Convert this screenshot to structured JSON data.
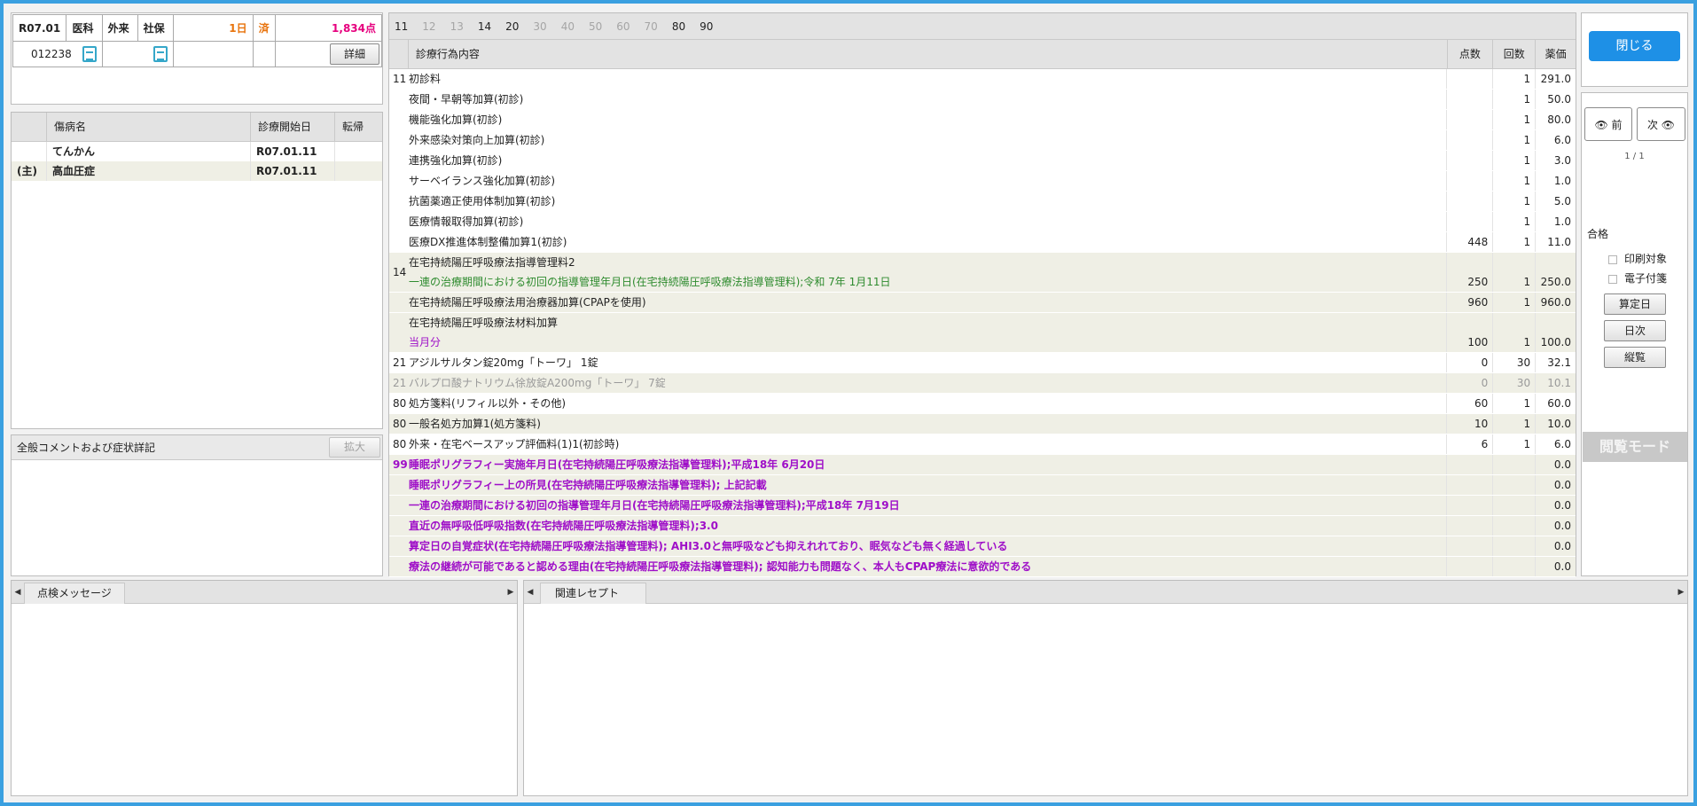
{
  "header": {
    "era_month": "R07.01",
    "department": "医科",
    "visit_type": "外来",
    "insurance": "社保",
    "days": "1日",
    "status": "済",
    "points": "1,834点",
    "patient_no": "012238",
    "detail_button": "詳細"
  },
  "disease": {
    "columns": {
      "name": "傷病名",
      "start_date": "診療開始日",
      "outcome": "転帰"
    },
    "rows": [
      {
        "mark": "",
        "name": "てんかん",
        "start_date": "R07.01.11",
        "outcome": ""
      },
      {
        "mark": "(主)",
        "name": "高血圧症",
        "start_date": "R07.01.11",
        "outcome": ""
      }
    ]
  },
  "comment": {
    "title": "全般コメントおよび症状詳記",
    "expand_button": "拡大"
  },
  "main": {
    "tabs": [
      {
        "label": "11",
        "active": true
      },
      {
        "label": "12",
        "active": false
      },
      {
        "label": "13",
        "active": false
      },
      {
        "label": "14",
        "active": true
      },
      {
        "label": "20",
        "active": true
      },
      {
        "label": "30",
        "active": false
      },
      {
        "label": "40",
        "active": false
      },
      {
        "label": "50",
        "active": false
      },
      {
        "label": "60",
        "active": false
      },
      {
        "label": "70",
        "active": false
      },
      {
        "label": "80",
        "active": true
      },
      {
        "label": "90",
        "active": true
      }
    ],
    "columns": {
      "name": "診療行為内容",
      "points": "点数",
      "count": "回数",
      "price": "薬価"
    },
    "rows": [
      {
        "code": "11",
        "lines": [
          "初診料"
        ],
        "points": "",
        "count": "1",
        "price": "291.0",
        "style": "normal"
      },
      {
        "code": "",
        "lines": [
          "夜間・早朝等加算(初診)"
        ],
        "points": "",
        "count": "1",
        "price": "50.0",
        "style": "normal"
      },
      {
        "code": "",
        "lines": [
          "機能強化加算(初診)"
        ],
        "points": "",
        "count": "1",
        "price": "80.0",
        "style": "normal"
      },
      {
        "code": "",
        "lines": [
          "外来感染対策向上加算(初診)"
        ],
        "points": "",
        "count": "1",
        "price": "6.0",
        "style": "normal"
      },
      {
        "code": "",
        "lines": [
          "連携強化加算(初診)"
        ],
        "points": "",
        "count": "1",
        "price": "3.0",
        "style": "normal"
      },
      {
        "code": "",
        "lines": [
          "サーベイランス強化加算(初診)"
        ],
        "points": "",
        "count": "1",
        "price": "1.0",
        "style": "normal"
      },
      {
        "code": "",
        "lines": [
          "抗菌薬適正使用体制加算(初診)"
        ],
        "points": "",
        "count": "1",
        "price": "5.0",
        "style": "normal"
      },
      {
        "code": "",
        "lines": [
          "医療情報取得加算(初診)"
        ],
        "points": "",
        "count": "1",
        "price": "1.0",
        "style": "normal"
      },
      {
        "code": "",
        "lines": [
          "医療DX推進体制整備加算1(初診)"
        ],
        "points": "448",
        "count": "1",
        "price": "11.0",
        "style": "normal"
      },
      {
        "code": "14",
        "lines": [
          "在宅持続陽圧呼吸療法指導管理料2",
          "一連の治療期間における初回の指導管理年月日(在宅持続陽圧呼吸療法指導管理料);令和 7年 1月11日"
        ],
        "sub_color": "green",
        "points": "250",
        "count": "1",
        "price": "250.0",
        "style": "alt"
      },
      {
        "code": "",
        "lines": [
          "在宅持続陽圧呼吸療法用治療器加算(CPAPを使用)"
        ],
        "points": "960",
        "count": "1",
        "price": "960.0",
        "style": "alt"
      },
      {
        "code": "",
        "lines": [
          "在宅持続陽圧呼吸療法材料加算",
          "当月分"
        ],
        "sub_color": "purple",
        "points": "100",
        "count": "1",
        "price": "100.0",
        "style": "alt"
      },
      {
        "code": "21",
        "lines": [
          "アジルサルタン錠20mg「トーワ」 1錠"
        ],
        "points": "0",
        "count": "30",
        "price": "32.1",
        "style": "normal"
      },
      {
        "code": "21",
        "lines": [
          "バルプロ酸ナトリウム徐放錠A200mg「トーワ」 7錠"
        ],
        "points": "0",
        "count": "30",
        "price": "10.1",
        "style": "gray"
      },
      {
        "code": "80",
        "lines": [
          "処方箋料(リフィル以外・その他)"
        ],
        "points": "60",
        "count": "1",
        "price": "60.0",
        "style": "normal"
      },
      {
        "code": "80",
        "lines": [
          "一般名処方加算1(処方箋料)"
        ],
        "points": "10",
        "count": "1",
        "price": "10.0",
        "style": "alt"
      },
      {
        "code": "80",
        "lines": [
          "外来・在宅ベースアップ評価料(1)1(初診時)"
        ],
        "points": "6",
        "count": "1",
        "price": "6.0",
        "style": "normal"
      },
      {
        "code": "99",
        "lines": [
          "睡眠ポリグラフィー実施年月日(在宅持続陽圧呼吸療法指導管理料);平成18年 6月20日"
        ],
        "points": "",
        "count": "",
        "price": "0.0",
        "style": "purple"
      },
      {
        "code": "",
        "lines": [
          "睡眠ポリグラフィー上の所見(在宅持続陽圧呼吸療法指導管理料); 上記記載"
        ],
        "points": "",
        "count": "",
        "price": "0.0",
        "style": "purple"
      },
      {
        "code": "",
        "lines": [
          "一連の治療期間における初回の指導管理年月日(在宅持続陽圧呼吸療法指導管理料);平成18年 7月19日"
        ],
        "points": "",
        "count": "",
        "price": "0.0",
        "style": "purple"
      },
      {
        "code": "",
        "lines": [
          "直近の無呼吸低呼吸指数(在宅持続陽圧呼吸療法指導管理料);3.0"
        ],
        "points": "",
        "count": "",
        "price": "0.0",
        "style": "purple"
      },
      {
        "code": "",
        "lines": [
          "算定日の自覚症状(在宅持続陽圧呼吸療法指導管理料); AHI3.0と無呼吸なども抑えれれており、眠気なども無く経過している"
        ],
        "points": "",
        "count": "",
        "price": "0.0",
        "style": "purple"
      },
      {
        "code": "",
        "lines": [
          "療法の継続が可能であると認める理由(在宅持続陽圧呼吸療法指導管理料); 認知能力も問題なく、本人もCPAP療法に意欲的である"
        ],
        "points": "",
        "count": "",
        "price": "0.0",
        "style": "purple"
      }
    ]
  },
  "side": {
    "close_button": "閉じる",
    "prev_button": "前",
    "next_button": "次",
    "page_indicator": "1 / 1",
    "result_label": "合格",
    "print_target": "印刷対象",
    "electronic_attach": "電子付箋",
    "calc_date_button": "算定日",
    "daily_button": "日次",
    "overview_button": "縦覧",
    "mode_label": "閲覧モード"
  },
  "bottom": {
    "check_tab": "点検メッセージ",
    "related_tab": "関連レセプト"
  },
  "colors": {
    "frame": "#3aa0e0",
    "close_button": "#1e90e6",
    "purple_text": "#9f0fc8",
    "green_text": "#2e8b2e",
    "pink_points": "#e6007e",
    "orange_days": "#e8730c"
  }
}
